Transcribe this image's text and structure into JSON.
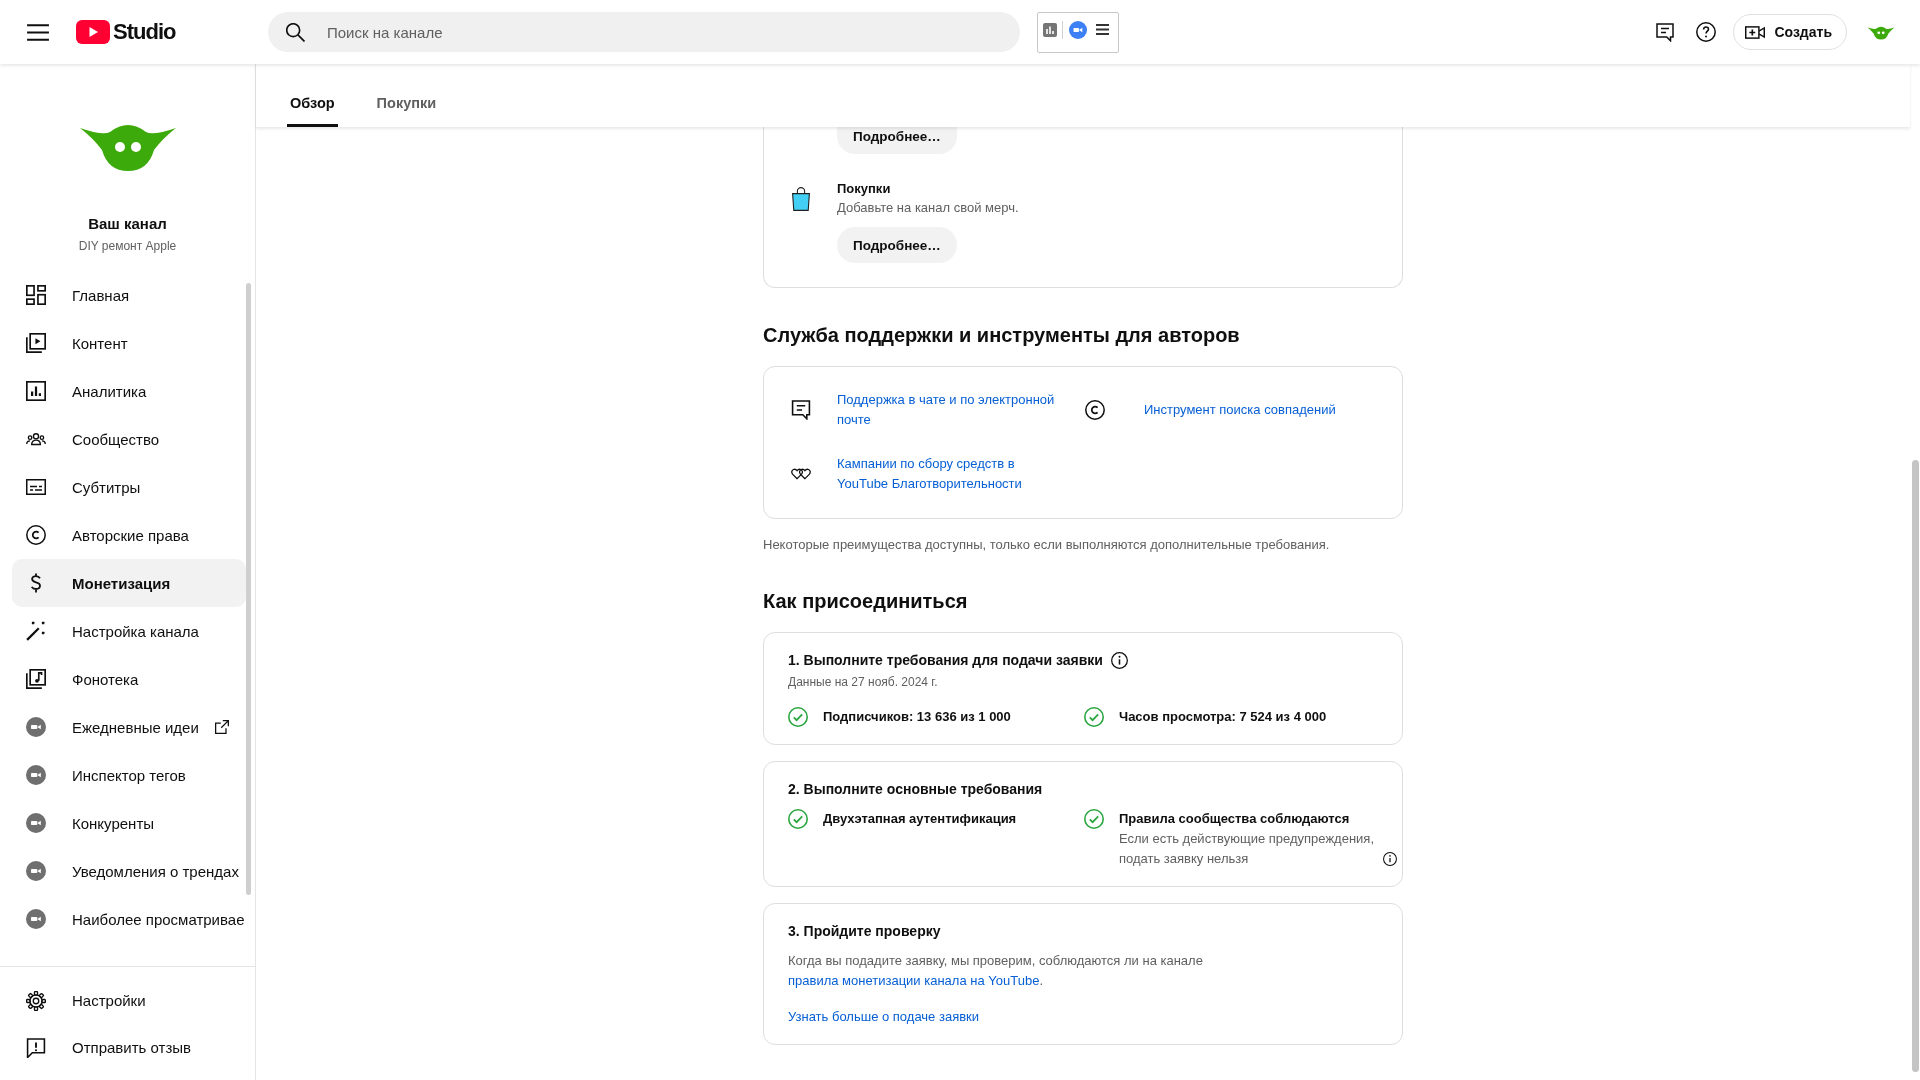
{
  "header": {
    "logo_text": "Studio",
    "search": {
      "placeholder": "Поиск на канале"
    },
    "create_button": "Создать"
  },
  "sidebar": {
    "channel": {
      "title": "Ваш канал",
      "name": "DIY ремонт Apple"
    },
    "items": [
      {
        "label": "Главная",
        "kind": "nav",
        "selected": false,
        "external": false
      },
      {
        "label": "Контент",
        "kind": "nav",
        "selected": false,
        "external": false
      },
      {
        "label": "Аналитика",
        "kind": "nav",
        "selected": false,
        "external": false
      },
      {
        "label": "Сообщество",
        "kind": "nav",
        "selected": false,
        "external": false
      },
      {
        "label": "Субтитры",
        "kind": "nav",
        "selected": false,
        "external": false
      },
      {
        "label": "Авторские права",
        "kind": "nav",
        "selected": false,
        "external": false
      },
      {
        "label": "Монетизация",
        "kind": "nav",
        "selected": true,
        "external": false
      },
      {
        "label": "Настройка канала",
        "kind": "nav",
        "selected": false,
        "external": false
      },
      {
        "label": "Фонотека",
        "kind": "nav",
        "selected": false,
        "external": false
      },
      {
        "label": "Ежедневные идеи",
        "kind": "extension",
        "selected": false,
        "external": true
      },
      {
        "label": "Инспектор тегов",
        "kind": "extension",
        "selected": false,
        "external": false
      },
      {
        "label": "Конкуренты",
        "kind": "extension",
        "selected": false,
        "external": false
      },
      {
        "label": "Уведомления о трендах",
        "kind": "extension",
        "selected": false,
        "external": false
      },
      {
        "label": "Наиболее просматривае",
        "kind": "extension",
        "selected": false,
        "external": false
      }
    ],
    "footer_items": [
      {
        "label": "Настройки"
      },
      {
        "label": "Отправить отзыв"
      }
    ]
  },
  "tabs": [
    {
      "label": "Обзор",
      "selected": true
    },
    {
      "label": "Покупки",
      "selected": false
    }
  ],
  "perks": {
    "items": [
      {
        "button": "Подробнее…"
      },
      {
        "title": "Покупки",
        "description": "Добавьте на канал свой мерч.",
        "button": "Подробнее…"
      }
    ]
  },
  "support": {
    "heading": "Служба поддержки и инструменты для авторов",
    "links": [
      {
        "label": "Поддержка в чате и по электронной почте"
      },
      {
        "label": "Инструмент поиска совпадений"
      },
      {
        "label": "Кампании по сбору средств в YouTube Благотворительности"
      }
    ],
    "note": "Некоторые преимущества доступны, только если выполняются дополнительные требования."
  },
  "join": {
    "heading": "Как присоединиться",
    "steps": [
      {
        "kind": "checklist",
        "title": "1. Выполните требования для подачи заявки",
        "info": true,
        "subtitle": "Данные на 27 нояб. 2024 г.",
        "requirements": [
          {
            "label": "Подписчиков: 13 636 из 1 000",
            "met": true,
            "info": false
          },
          {
            "label": "Часов просмотра: 7 524 из 4 000",
            "met": true,
            "info": false
          }
        ]
      },
      {
        "kind": "checklist",
        "title": "2. Выполните основные требования",
        "info": false,
        "requirements": [
          {
            "label": "Двухэтапная аутентификация",
            "met": true,
            "info": false
          },
          {
            "label": "Правила сообщества соблюдаются",
            "met": true,
            "description": "Если есть действующие предупреждения, подать заявку нельзя",
            "info": true
          }
        ]
      },
      {
        "kind": "review",
        "title": "3. Пройдите проверку",
        "info": false,
        "text_before": "Когда вы подадите заявку, мы проверим, соблюдаются ли на канале",
        "link_text": "правила монетизации канала на YouTube",
        "text_after": ".",
        "link": "Узнать больше о подаче заявки"
      }
    ]
  }
}
